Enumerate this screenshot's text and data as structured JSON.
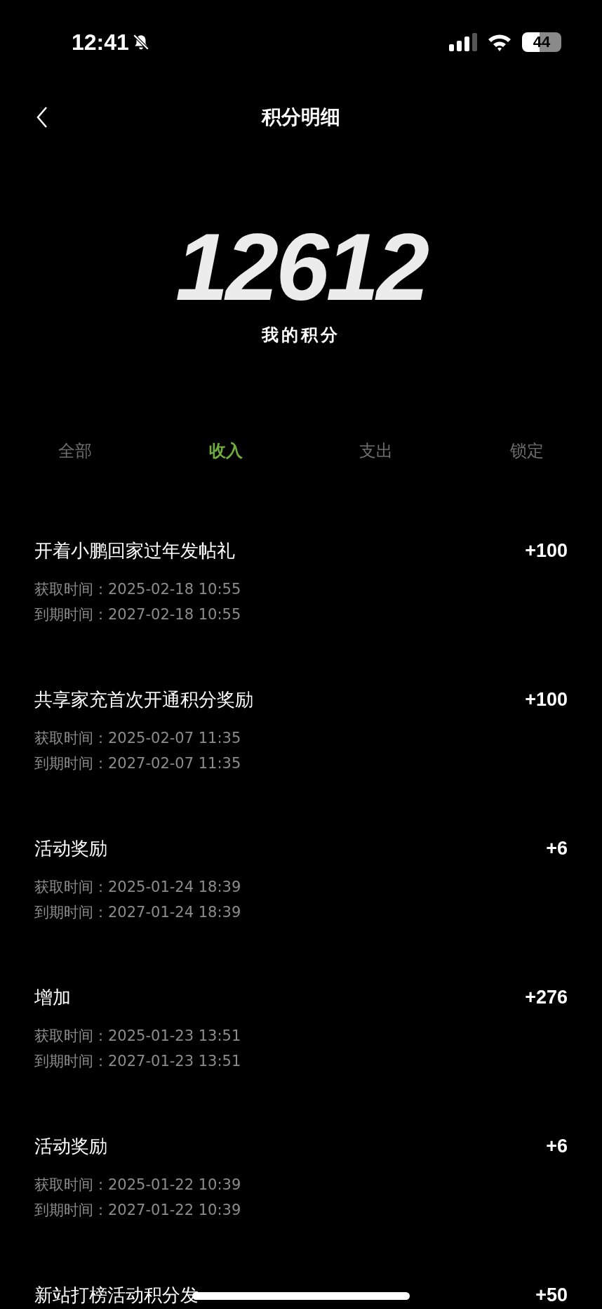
{
  "status_bar": {
    "time": "12:41",
    "battery": "44"
  },
  "header": {
    "title": "积分明细"
  },
  "points": {
    "value": "12612",
    "label": "我的积分"
  },
  "tabs": [
    {
      "label": "全部",
      "selected": false
    },
    {
      "label": "收入",
      "selected": true
    },
    {
      "label": "支出",
      "selected": false
    },
    {
      "label": "锁定",
      "selected": false
    }
  ],
  "records": [
    {
      "title": "开着小鹏回家过年发帖礼",
      "amount": "+100",
      "details": [
        "获取时间：2025-02-18 10:55",
        "到期时间：2027-02-18 10:55"
      ]
    },
    {
      "title": "共享家充首次开通积分奖励",
      "amount": "+100",
      "details": [
        "获取时间：2025-02-07 11:35",
        "到期时间：2027-02-07 11:35"
      ]
    },
    {
      "title": "活动奖励",
      "amount": "+6",
      "details": [
        "获取时间：2025-01-24 18:39",
        "到期时间：2027-01-24 18:39"
      ]
    },
    {
      "title": "增加",
      "amount": "+276",
      "details": [
        "获取时间：2025-01-23 13:51",
        "到期时间：2027-01-23 13:51"
      ]
    },
    {
      "title": "活动奖励",
      "amount": "+6",
      "details": [
        "获取时间：2025-01-22 10:39",
        "到期时间：2027-01-22 10:39"
      ]
    },
    {
      "title": "新站打榜活动积分发",
      "amount": "+50"
    }
  ]
}
